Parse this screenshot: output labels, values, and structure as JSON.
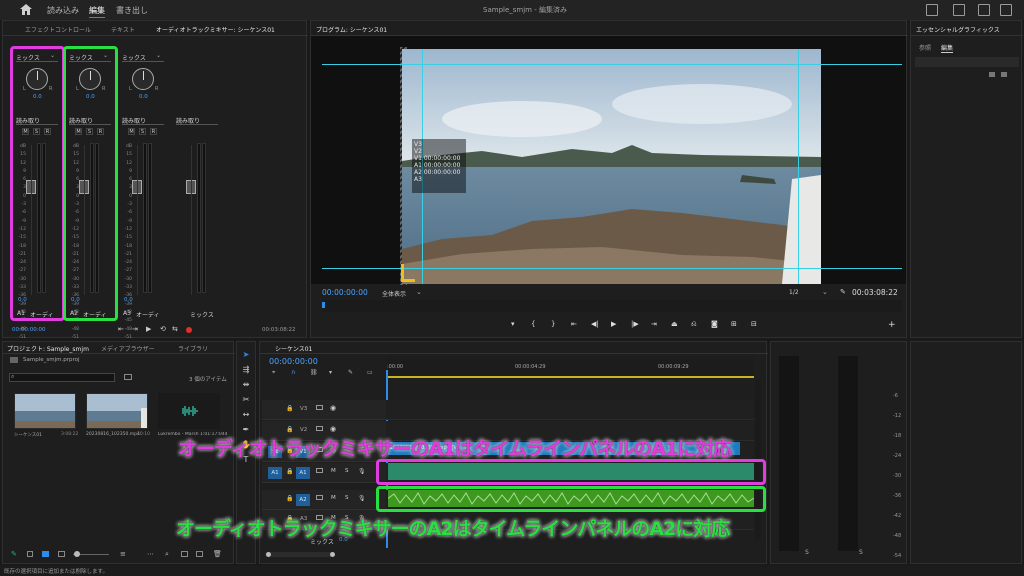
{
  "topbar": {
    "tabs": [
      "読み込み",
      "編集",
      "書き出し"
    ],
    "active": "編集",
    "title": "Sample_smjm - 編集済み"
  },
  "left_tabs": [
    "エフェクトコントロール",
    "テキスト",
    "オーディオトラックミキサー: シーケンス01"
  ],
  "mixer": {
    "mix_label": "ミックス",
    "readmode": "読み取り",
    "value": "0.0",
    "scale": [
      "dB",
      "15",
      "12",
      "9",
      "6",
      "3",
      "0",
      "-3",
      "-6",
      "-9",
      "-12",
      "-15",
      "-18",
      "-21",
      "-24",
      "-27",
      "-30",
      "-33",
      "-36",
      "-39",
      "-42",
      "-45",
      "-48",
      "-51",
      "-54",
      "-57",
      "dB"
    ],
    "channels": [
      {
        "id": "A1",
        "name": "オーディ"
      },
      {
        "id": "A2",
        "name": "オーディ"
      },
      {
        "id": "A3",
        "name": "オーディ"
      },
      {
        "id": "",
        "name": "ミックス"
      }
    ],
    "timecode_left": "00:00:00:00",
    "timecode_right": "00:03:08:22"
  },
  "program": {
    "title": "プログラム: シーケンス01",
    "timecode": "00:00:00:00",
    "fit": "全体表示",
    "fraction": "1/2",
    "duration": "00:03:08:22",
    "track_overlay": [
      "V3",
      "V2",
      "V1 00:00:00:00",
      "A1 00:00:00:00",
      "A2 00:00:00:00",
      "A3"
    ]
  },
  "essential": {
    "title": "エッセンシャルグラフィックス",
    "tabs": [
      "参照",
      "編集"
    ]
  },
  "project": {
    "tabs": [
      "プロジェクト: Sample_smjm",
      "メディアブラウザー",
      "ライブラリ"
    ],
    "file": "Sample_smjm.prproj",
    "items_count": "3 個のアイテム",
    "items": [
      {
        "name": "シーケンス01",
        "dur": "3:08:22"
      },
      {
        "name": "20230816_102350.mp4",
        "dur": "10:10"
      },
      {
        "name": "Lukrembo - Marsh 1:01:17:044",
        "dur": ""
      }
    ]
  },
  "timeline": {
    "title": "シーケンス01",
    "timecode": "00:00:00:00",
    "ruler": [
      ":00:00",
      "00:00:04:29",
      "00:00:09:29"
    ],
    "tracks": [
      {
        "id": "V3"
      },
      {
        "id": "V2"
      },
      {
        "id": "V1",
        "clip": "20230816_102350.mp4 [V]"
      },
      {
        "id": "A1"
      },
      {
        "id": "A2"
      },
      {
        "id": "A3"
      }
    ],
    "mix_row": "ミックス",
    "mix_val": "0.0",
    "ms_m": "M",
    "ms_s": "S",
    "ms_r": "R"
  },
  "meter": {
    "scale": [
      "-6",
      "-12",
      "-18",
      "-24",
      "-30",
      "-36",
      "-42",
      "-48",
      "-54"
    ],
    "bottom": [
      "S",
      "S"
    ]
  },
  "annotations": {
    "a1": "オーディオトラックミキサーのA1はタイムラインパネルのA1に対応",
    "a2": "オーディオトラックミキサーのA2はタイムラインパネルのA2に対応"
  },
  "status": "既存の選択項目に追加または削除します。",
  "colors": {
    "pink": "#e03ce0",
    "green": "#28e040",
    "accent": "#2d8ceb"
  }
}
